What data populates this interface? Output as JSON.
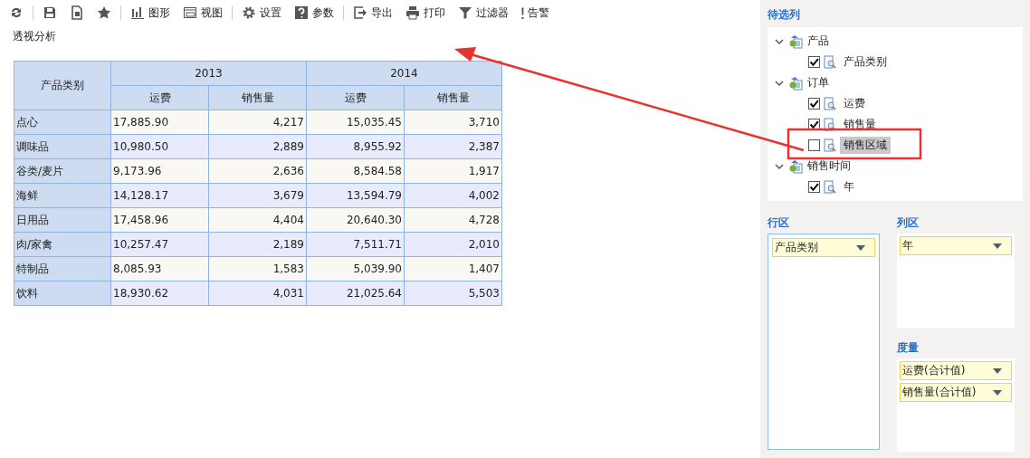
{
  "toolbar": [
    {
      "kind": "refresh"
    },
    {
      "kind": "save"
    },
    {
      "kind": "saveas"
    },
    {
      "kind": "star"
    },
    {
      "kind": "chart",
      "label": "图形"
    },
    {
      "kind": "view",
      "label": "视图"
    },
    {
      "kind": "gear",
      "label": "设置"
    },
    {
      "kind": "help",
      "label": "参数"
    },
    {
      "kind": "export",
      "label": "导出"
    },
    {
      "kind": "print",
      "label": "打印"
    },
    {
      "kind": "filter",
      "label": "过滤器"
    },
    {
      "kind": "alert",
      "label": "告警"
    }
  ],
  "title": "透视分析",
  "table": {
    "row_header": "产品类别",
    "years": [
      "2013",
      "2014"
    ],
    "measures": [
      "运费",
      "销售量",
      "运费",
      "销售量"
    ],
    "rows": [
      [
        "点心",
        "17,885.90",
        "4,217",
        "15,035.45",
        "3,710"
      ],
      [
        "调味品",
        "10,980.50",
        "2,889",
        "8,955.92",
        "2,387"
      ],
      [
        "谷类/麦片",
        "9,173.96",
        "2,636",
        "8,584.58",
        "1,917"
      ],
      [
        "海鲜",
        "14,128.17",
        "3,679",
        "13,594.79",
        "4,002"
      ],
      [
        "日用品",
        "17,458.96",
        "4,404",
        "20,640.30",
        "4,728"
      ],
      [
        "肉/家禽",
        "10,257.47",
        "2,189",
        "7,511.71",
        "2,010"
      ],
      [
        "特制品",
        "8,085.93",
        "1,583",
        "5,039.90",
        "1,407"
      ],
      [
        "饮料",
        "18,930.62",
        "4,031",
        "21,025.64",
        "5,503"
      ]
    ]
  },
  "candidates": {
    "title": "待选列",
    "tree": [
      {
        "label": "产品",
        "expanded": true,
        "children": [
          {
            "label": "产品类别",
            "checked": true,
            "selected": false
          }
        ]
      },
      {
        "label": "订单",
        "expanded": true,
        "children": [
          {
            "label": "运费",
            "checked": true,
            "selected": false
          },
          {
            "label": "销售量",
            "checked": true,
            "selected": false
          },
          {
            "label": "销售区域",
            "checked": false,
            "selected": true
          }
        ]
      },
      {
        "label": "销售时间",
        "expanded": true,
        "children": [
          {
            "label": "年",
            "checked": true,
            "selected": false
          }
        ]
      }
    ]
  },
  "row_area": {
    "title": "行区",
    "fields": [
      "产品类别"
    ]
  },
  "column_area": {
    "title": "列区",
    "fields": [
      "年"
    ]
  },
  "measure_area": {
    "title": "度量",
    "fields": [
      "运费(合计值)",
      "销售量(合计值)"
    ]
  }
}
